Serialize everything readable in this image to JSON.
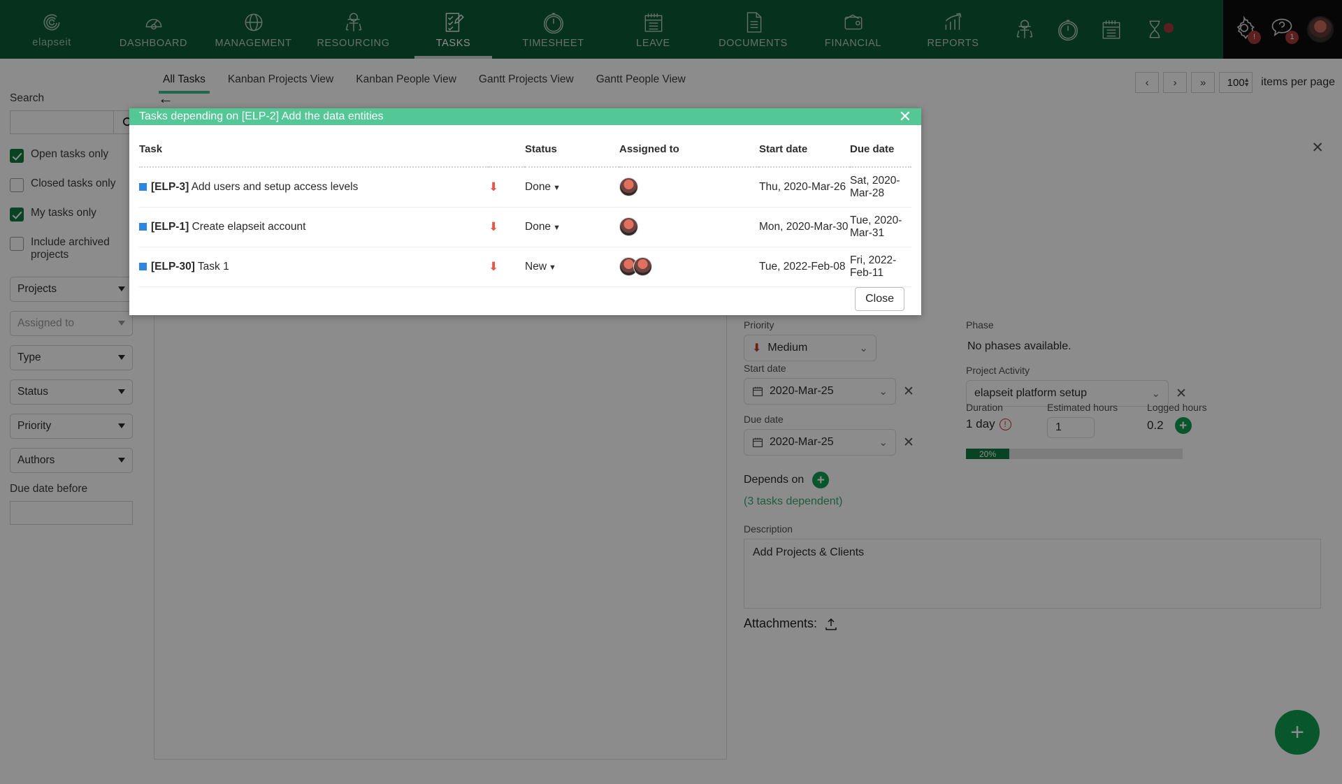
{
  "app": {
    "brand": "elapseit"
  },
  "nav": {
    "items": [
      {
        "label": "DASHBOARD",
        "icon": "dashboard-icon",
        "active": false
      },
      {
        "label": "MANAGEMENT",
        "icon": "globe-icon",
        "active": false
      },
      {
        "label": "RESOURCING",
        "icon": "worker-icon",
        "active": false
      },
      {
        "label": "TASKS",
        "icon": "checklist-icon",
        "active": true
      },
      {
        "label": "TIMESHEET",
        "icon": "stopwatch-icon",
        "active": false
      },
      {
        "label": "LEAVE",
        "icon": "calendar-icon",
        "active": false
      },
      {
        "label": "DOCUMENTS",
        "icon": "document-icon",
        "active": false
      },
      {
        "label": "FINANCIAL",
        "icon": "wallet-icon",
        "active": false
      },
      {
        "label": "REPORTS",
        "icon": "chart-up-icon",
        "active": false
      }
    ],
    "quick_icons": [
      {
        "icon": "worker-icon"
      },
      {
        "icon": "stopwatch-icon"
      },
      {
        "icon": "calendar-icon"
      },
      {
        "icon": "hourglass-icon",
        "has_dot": true
      }
    ],
    "right": {
      "settings_icon": "gear-icon",
      "settings_badge": "!",
      "help_icon": "help-chat-icon",
      "help_badge": "1",
      "avatar": "user-avatar"
    }
  },
  "tabs": [
    {
      "label": "All Tasks",
      "active": true
    },
    {
      "label": "Kanban Projects View",
      "active": false
    },
    {
      "label": "Kanban People View",
      "active": false
    },
    {
      "label": "Gantt Projects View",
      "active": false
    },
    {
      "label": "Gantt People View",
      "active": false
    }
  ],
  "sidebar": {
    "search_label": "Search",
    "search_value": "",
    "search_placeholder": "",
    "checkboxes": [
      {
        "label": "Open tasks only",
        "checked": true
      },
      {
        "label": "Closed tasks only",
        "checked": false
      },
      {
        "label": "My tasks only",
        "checked": true
      },
      {
        "label": "Include archived projects",
        "checked": false
      }
    ],
    "selects": [
      {
        "label": "Projects",
        "muted": false
      },
      {
        "label": "Assigned to",
        "muted": true
      },
      {
        "label": "Type",
        "muted": false
      },
      {
        "label": "Status",
        "muted": false
      },
      {
        "label": "Priority",
        "muted": false
      },
      {
        "label": "Authors",
        "muted": false
      }
    ],
    "due_date_before_label": "Due date before",
    "due_date_before_value": ""
  },
  "toolbar": {
    "prev_label": "‹",
    "next_label": "›",
    "last_label": "»",
    "per_page_value": "100",
    "items_per_page_label": "items per page"
  },
  "modal": {
    "title": "Tasks depending on [ELP-2] Add the data entities",
    "close_icon": "close-icon",
    "close_button": "Close",
    "columns": [
      "Task",
      "",
      "Status",
      "Assigned to",
      "Start date",
      "Due date"
    ],
    "rows": [
      {
        "key": "[ELP-3]",
        "name": "Add users and setup access levels",
        "priority_icon": "arrow-down-icon",
        "status": "Done",
        "assignees": 1,
        "start_date": "Thu, 2020-Mar-26",
        "due_date": "Sat, 2020-Mar-28"
      },
      {
        "key": "[ELP-1]",
        "name": "Create elapseit account",
        "priority_icon": "arrow-down-icon",
        "status": "Done",
        "assignees": 1,
        "start_date": "Mon, 2020-Mar-30",
        "due_date": "Tue, 2020-Mar-31"
      },
      {
        "key": "[ELP-30]",
        "name": "Task 1",
        "priority_icon": "arrow-down-icon",
        "status": "New",
        "assignees": 2,
        "start_date": "Tue, 2022-Feb-08",
        "due_date": "Fri, 2022-Feb-11"
      }
    ]
  },
  "detail": {
    "project_link": "project",
    "priority_label": "Priority",
    "priority_value": "Medium",
    "phase_label": "Phase",
    "phase_value": "No phases available.",
    "start_date_label": "Start date",
    "start_date_value": "2020-Mar-25",
    "project_activity_label": "Project Activity",
    "project_activity_value": "elapseit platform setup",
    "due_date_label": "Due date",
    "due_date_value": "2020-Mar-25",
    "duration_label": "Duration",
    "duration_value": "1 day",
    "estimated_hours_label": "Estimated hours",
    "estimated_hours_value": "1",
    "logged_hours_label": "Logged hours",
    "logged_hours_value": "0.2",
    "progress_label": "20%",
    "progress_percent": 20,
    "depends_on_label": "Depends on",
    "dependents_label": "(3 tasks dependent)",
    "description_label": "Description",
    "description_value": "Add Projects & Clients",
    "attachments_label": "Attachments:"
  },
  "colors": {
    "nav_green": "#0b5c36",
    "modal_green": "#53c795",
    "accent_green": "#0f9d4f",
    "checkbox_green": "#107a41",
    "priority_red": "#c0392b"
  }
}
